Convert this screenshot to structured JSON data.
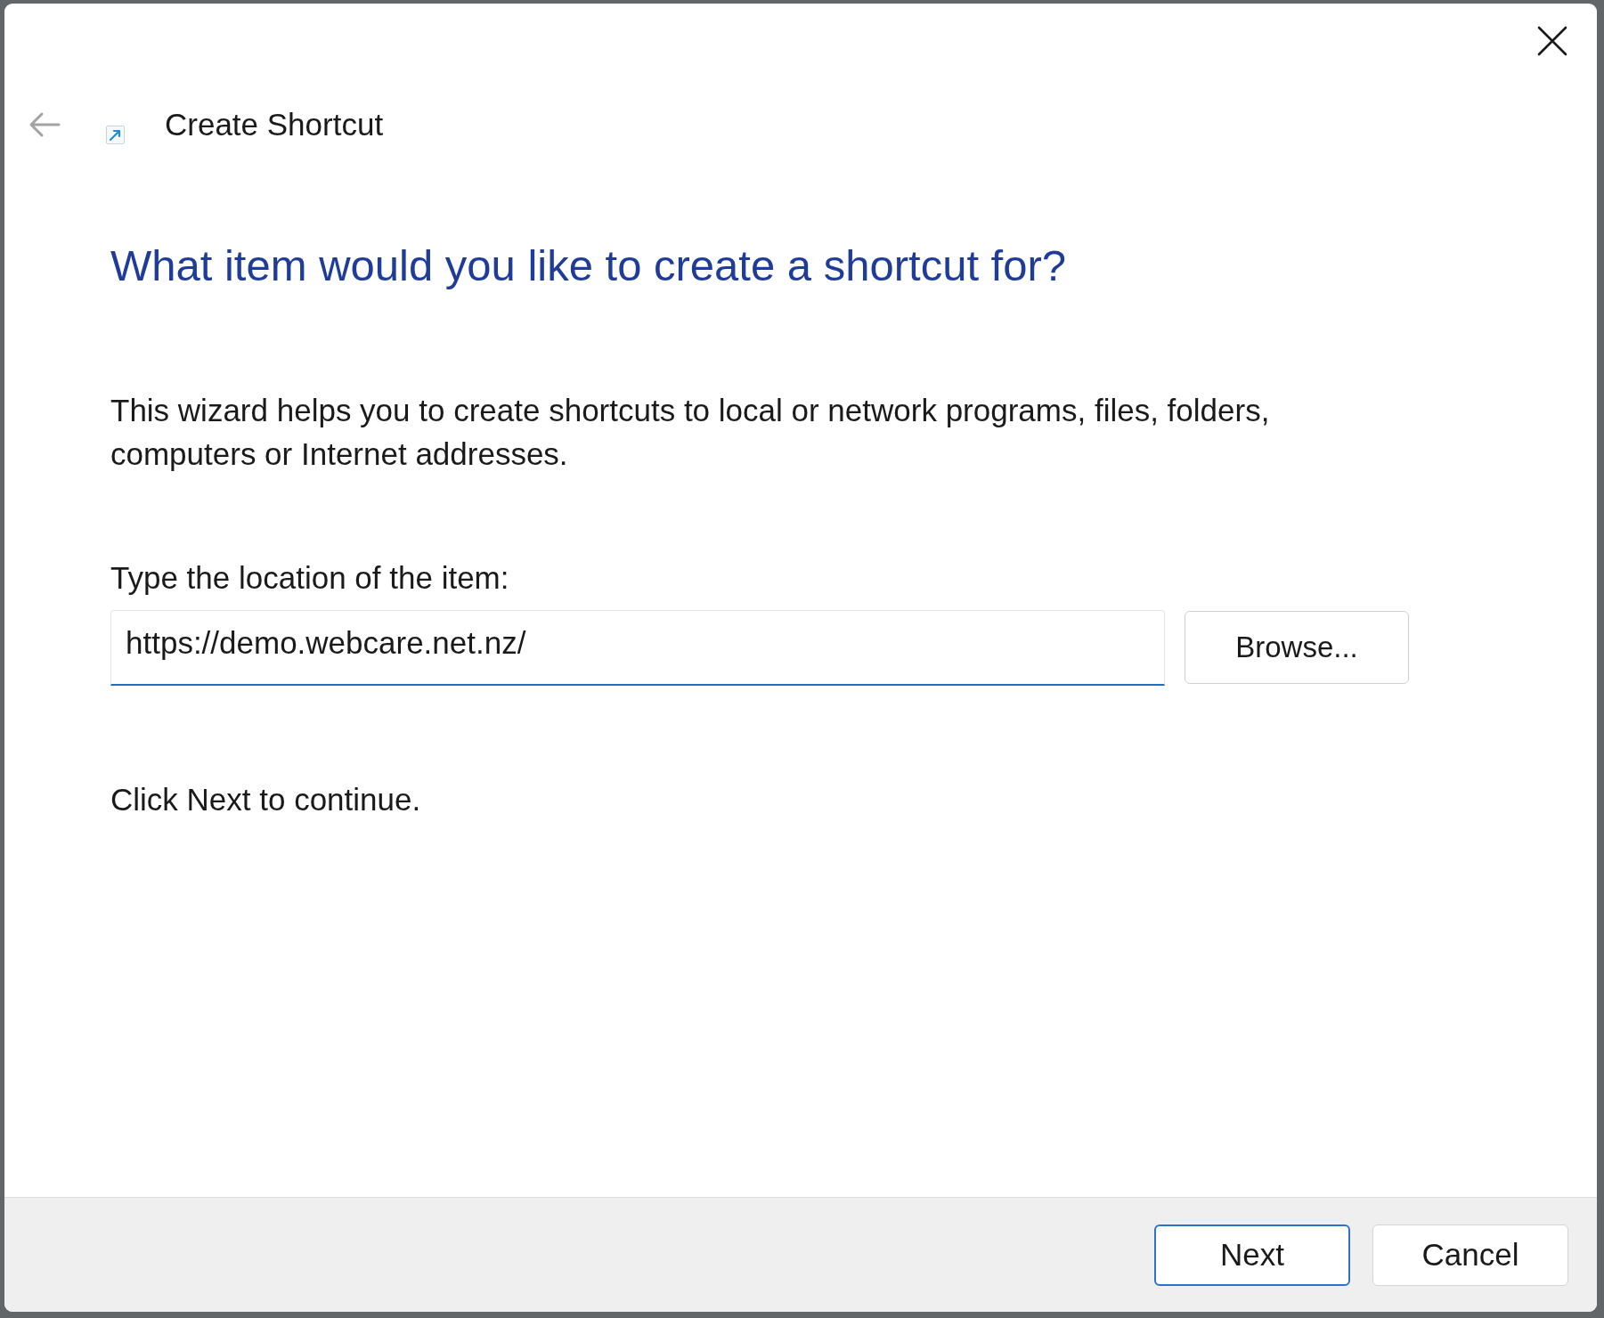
{
  "window": {
    "title": "Create Shortcut",
    "back_button": {
      "disabled": true
    }
  },
  "heading": "What item would you like to create a shortcut for?",
  "description": "This wizard helps you to create shortcuts to local or network programs, files, folders, computers or Internet addresses.",
  "location": {
    "label": "Type the location of the item:",
    "value": "https://demo.webcare.net.nz/",
    "focused": true,
    "browse_button": "Browse..."
  },
  "instruction": "Click Next to continue.",
  "buttons": [
    {
      "label": "Next",
      "default": true
    },
    {
      "label": "Cancel",
      "default": false
    }
  ]
}
